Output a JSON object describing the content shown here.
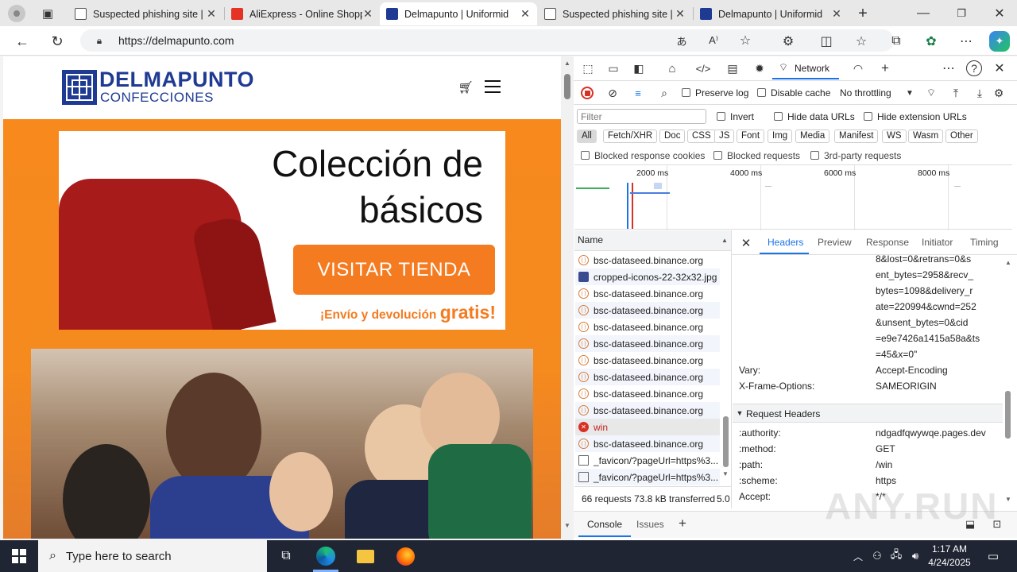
{
  "browser": {
    "tabs": [
      {
        "title": "Suspected phishing site | ",
        "favicon": "document-icon"
      },
      {
        "title": "AliExpress - Online Shopp",
        "favicon": "aliexpress-icon"
      },
      {
        "title": "Delmapunto | Uniformid",
        "favicon": "delmapunto-icon",
        "active": true
      },
      {
        "title": "Suspected phishing site | ",
        "favicon": "document-icon"
      },
      {
        "title": "Delmapunto | Uniformid",
        "favicon": "delmapunto-icon"
      }
    ],
    "url": "https://delmapunto.com"
  },
  "site": {
    "logo_title": "DELMAPUNTO",
    "logo_subtitle": "CONFECCIONES",
    "banner_line1": "Colección de",
    "banner_line2": "básicos",
    "banner_button": "VISITAR TIENDA",
    "banner_ship": "¡Envío y devolución ",
    "banner_free": "gratis!"
  },
  "devtools": {
    "tool_tab": "Network",
    "preserve_log": "Preserve log",
    "disable_cache": "Disable cache",
    "throttle": "No throttling",
    "filter_placeholder": "Filter",
    "invert": "Invert",
    "hide_data": "Hide data URLs",
    "hide_ext": "Hide extension URLs",
    "types": [
      "All",
      "Fetch/XHR",
      "Doc",
      "CSS",
      "JS",
      "Font",
      "Img",
      "Media",
      "Manifest",
      "WS",
      "Wasm",
      "Other"
    ],
    "blocked_cookies": "Blocked response cookies",
    "blocked_requests": "Blocked requests",
    "third_party": "3rd-party requests",
    "timeline_ticks": [
      "2000 ms",
      "4000 ms",
      "6000 ms",
      "8000 ms"
    ],
    "name_header": "Name",
    "requests": [
      {
        "name": "bsc-dataseed.binance.org",
        "type": "xhr"
      },
      {
        "name": "cropped-iconos-22-32x32.jpg",
        "type": "img"
      },
      {
        "name": "bsc-dataseed.binance.org",
        "type": "xhr"
      },
      {
        "name": "bsc-dataseed.binance.org",
        "type": "xhr"
      },
      {
        "name": "bsc-dataseed.binance.org",
        "type": "xhr"
      },
      {
        "name": "bsc-dataseed.binance.org",
        "type": "xhr"
      },
      {
        "name": "bsc-dataseed.binance.org",
        "type": "xhr"
      },
      {
        "name": "bsc-dataseed.binance.org",
        "type": "xhr"
      },
      {
        "name": "bsc-dataseed.binance.org",
        "type": "xhr"
      },
      {
        "name": "bsc-dataseed.binance.org",
        "type": "xhr"
      },
      {
        "name": "win",
        "type": "error"
      },
      {
        "name": "bsc-dataseed.binance.org",
        "type": "xhr"
      },
      {
        "name": "_favicon/?pageUrl=https%3...",
        "type": "doc"
      },
      {
        "name": "_favicon/?pageUrl=https%3...",
        "type": "doc"
      }
    ],
    "status_requests": "66 requests",
    "status_transferred": "73.8 kB transferred",
    "status_extra": "5.0",
    "detail_tabs": [
      "Headers",
      "Preview",
      "Response",
      "Initiator",
      "Timing"
    ],
    "header_continuation": [
      "8&lost=0&retrans=0&s",
      "ent_bytes=2958&recv_",
      "bytes=1098&delivery_r",
      "ate=220994&cwnd=252",
      "&unsent_bytes=0&cid",
      "=e9e7426a1415a58a&ts",
      "=45&x=0\""
    ],
    "response_headers": [
      {
        "key": "Vary:",
        "value": "Accept-Encoding"
      },
      {
        "key": "X-Frame-Options:",
        "value": "SAMEORIGIN"
      }
    ],
    "request_section": "Request Headers",
    "request_headers": [
      {
        "key": ":authority:",
        "value": "ndgadfqwywqe.pages.dev"
      },
      {
        "key": ":method:",
        "value": "GET"
      },
      {
        "key": ":path:",
        "value": "/win"
      },
      {
        "key": ":scheme:",
        "value": "https"
      },
      {
        "key": "Accept:",
        "value": "*/*"
      }
    ],
    "drawer_console": "Console",
    "drawer_issues": "Issues"
  },
  "taskbar": {
    "search_placeholder": "Type here to search",
    "time": "1:17 AM",
    "date": "4/24/2025"
  },
  "watermark": "ANY.RUN"
}
